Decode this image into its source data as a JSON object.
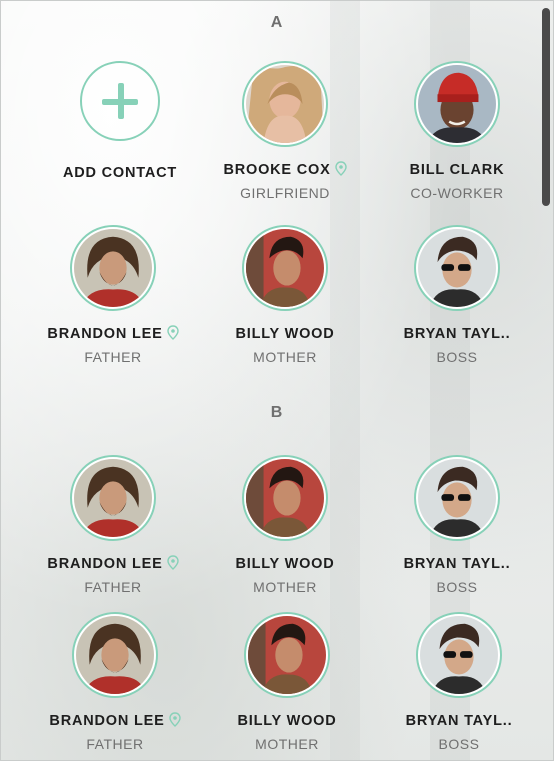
{
  "sections": [
    {
      "letter": "A"
    },
    {
      "letter": "B"
    }
  ],
  "add_contact_label": "ADD CONTACT",
  "contacts": [
    {
      "name": "BROOKE COX",
      "relation": "GIRLFRIEND",
      "pin": true,
      "avatar": "woman-portrait"
    },
    {
      "name": "BILL CLARK",
      "relation": "CO-WORKER",
      "pin": false,
      "avatar": "man-red-beanie"
    },
    {
      "name": "BRANDON LEE",
      "relation": "FATHER",
      "pin": true,
      "avatar": "man-long-hair-beard"
    },
    {
      "name": "BILLY WOOD",
      "relation": "MOTHER",
      "pin": false,
      "avatar": "man-dark-hair-red-bg"
    },
    {
      "name": "BRYAN TAYL..",
      "relation": "BOSS",
      "pin": false,
      "avatar": "man-sunglasses"
    },
    {
      "name": "BRANDON LEE",
      "relation": "FATHER",
      "pin": true,
      "avatar": "man-long-hair-beard"
    },
    {
      "name": "BILLY WOOD",
      "relation": "MOTHER",
      "pin": false,
      "avatar": "man-dark-hair-red-bg"
    },
    {
      "name": "BRYAN TAYL..",
      "relation": "BOSS",
      "pin": false,
      "avatar": "man-sunglasses"
    },
    {
      "name": "BRANDON LEE",
      "relation": "FATHER",
      "pin": true,
      "avatar": "man-long-hair-beard"
    },
    {
      "name": "BILLY WOOD",
      "relation": "MOTHER",
      "pin": false,
      "avatar": "man-dark-hair-red-bg"
    },
    {
      "name": "BRYAN TAYL..",
      "relation": "BOSS",
      "pin": false,
      "avatar": "man-sunglasses"
    }
  ],
  "colors": {
    "accent": "#87d1b8",
    "name_text": "#1e1e1e",
    "relation_text": "#707070"
  }
}
